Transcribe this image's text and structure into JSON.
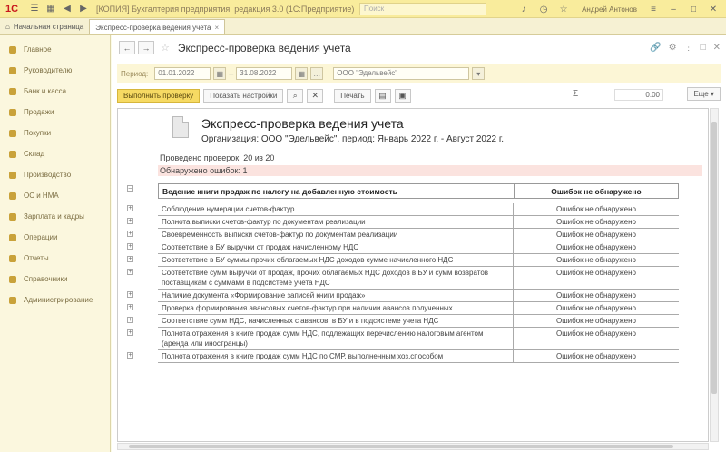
{
  "app": {
    "logo": "1С",
    "title": "[КОПИЯ] Бухгалтерия предприятия, редакция 3.0 (1С:Предприятие)",
    "search_placeholder": "Поиск",
    "user": "Андрей Антонов"
  },
  "tabs": [
    {
      "label": "Начальная страница"
    },
    {
      "label": "Экспресс-проверка ведения учета"
    }
  ],
  "sidebar": {
    "items": [
      {
        "label": "Главное",
        "icon": "list-icon"
      },
      {
        "label": "Руководителю",
        "icon": "chart-icon"
      },
      {
        "label": "Банк и касса",
        "icon": "bank-icon"
      },
      {
        "label": "Продажи",
        "icon": "cart-icon"
      },
      {
        "label": "Покупки",
        "icon": "basket-icon"
      },
      {
        "label": "Склад",
        "icon": "warehouse-icon"
      },
      {
        "label": "Производство",
        "icon": "factory-icon"
      },
      {
        "label": "ОС и НМА",
        "icon": "assets-icon"
      },
      {
        "label": "Зарплата и кадры",
        "icon": "people-icon"
      },
      {
        "label": "Операции",
        "icon": "operations-icon"
      },
      {
        "label": "Отчеты",
        "icon": "reports-icon"
      },
      {
        "label": "Справочники",
        "icon": "book-icon"
      },
      {
        "label": "Администрирование",
        "icon": "gear-icon"
      }
    ]
  },
  "form": {
    "title": "Экспресс-проверка ведения учета",
    "period_label": "Период:",
    "date_from": "01.01.2022",
    "date_to": "31.08.2022",
    "organization": "ООО \"Эдельвейс\"",
    "run_button": "Выполнить проверку",
    "settings_button": "Показать настройки",
    "print_button": "Печать",
    "sum_value": "0.00",
    "more_button": "Еще"
  },
  "report": {
    "title": "Экспресс-проверка ведения учета",
    "subtitle": "Организация: ООО \"Эдельвейс\", период: Январь 2022 г. - Август 2022 г.",
    "checks_done": "Проведено проверок: 20 из 20",
    "errors_found": "Обнаружено ошибок: 1",
    "header_section": "Ведение книги продаж по налогу на добавленную стоимость",
    "header_status": "Ошибок не обнаружено",
    "rows": [
      {
        "check": "Соблюдение нумерации счетов-фактур",
        "status": "Ошибок не обнаружено"
      },
      {
        "check": "Полнота выписки счетов-фактур по документам реализации",
        "status": "Ошибок не обнаружено"
      },
      {
        "check": "Своевременность выписки счетов-фактур по документам реализации",
        "status": "Ошибок не обнаружено"
      },
      {
        "check": "Соответствие в БУ выручки от продаж начисленному НДС",
        "status": "Ошибок не обнаружено"
      },
      {
        "check": "Соответствие в БУ суммы прочих облагаемых НДС доходов сумме начисленного НДС",
        "status": "Ошибок не обнаружено"
      },
      {
        "check": "Соответствие сумм выручки от продаж, прочих облагаемых НДС доходов в БУ и сумм возвратов поставщикам с суммами в подсистеме учета НДС",
        "status": "Ошибок не обнаружено"
      },
      {
        "check": "Наличие документа «Формирование записей книги продаж»",
        "status": "Ошибок не обнаружено"
      },
      {
        "check": "Проверка формирования авансовых счетов-фактур при наличии авансов полученных",
        "status": "Ошибок не обнаружено"
      },
      {
        "check": "Соответствие сумм НДС, начисленных с авансов, в БУ и в подсистеме учета НДС",
        "status": "Ошибок не обнаружено"
      },
      {
        "check": "Полнота отражения в книге продаж сумм НДС, подлежащих перечислению налоговым агентом (аренда или иностранцы)",
        "status": "Ошибок не обнаружено"
      },
      {
        "check": "Полнота отражения в книге продаж сумм НДС по СМР, выполненным хоз.способом",
        "status": "Ошибок не обнаружено"
      }
    ]
  }
}
